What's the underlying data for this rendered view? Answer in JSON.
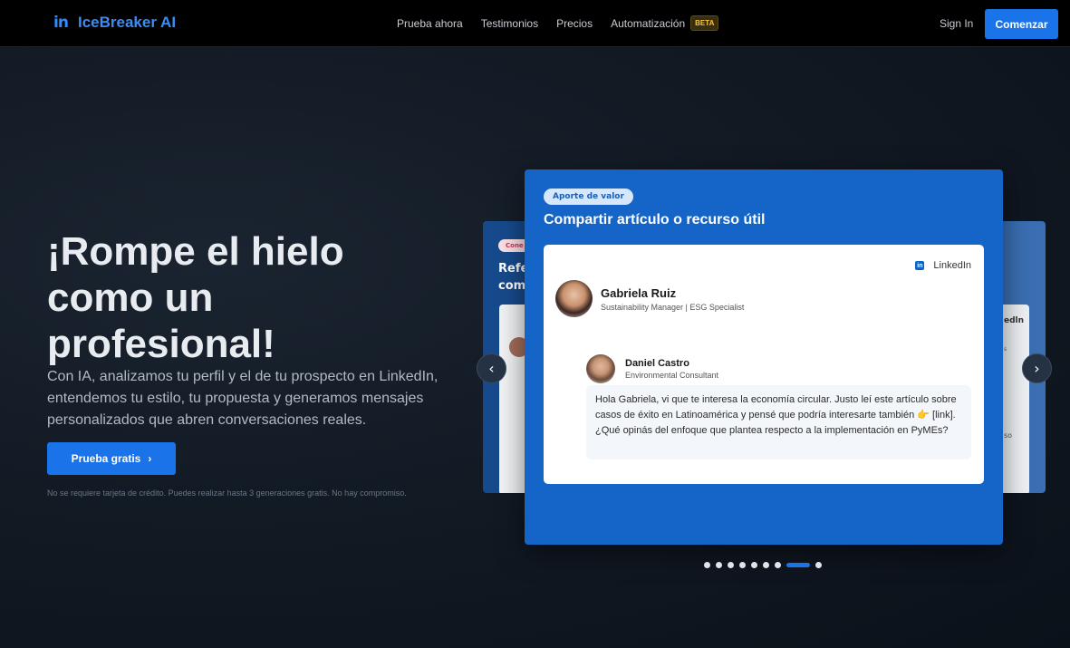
{
  "nav": {
    "logo_text": "IceBreaker AI",
    "links": [
      "Prueba ahora",
      "Testimonios",
      "Precios",
      "Automatización"
    ],
    "beta_badge": "BETA",
    "signin": "Sign In",
    "cta": "Comenzar"
  },
  "hero": {
    "title_line1": "¡Rompe el hielo",
    "title_line2": "como un",
    "title_line3": "profesional!",
    "subtitle": "Con IA, analizamos tu perfil y el de tu prospecto en LinkedIn, entendemos tu estilo, tu propuesta y generamos mensajes personalizados que abren conversaciones reales.",
    "button": "Prueba gratis",
    "disclaimer": "No se requiere tarjeta de crédito. Puedes realizar hasta 3 generaciones gratis. No hay compromiso."
  },
  "carousel": {
    "left_card": {
      "tag": "Cone",
      "title_line1": "Refe",
      "title_line2": "com"
    },
    "right_card": {
      "text1": "edln",
      "text2": "s",
      "text3": "so"
    },
    "main_card": {
      "tag": "Aporte de valor",
      "title": "Compartir artículo o recurso útil",
      "platform": "LinkedIn",
      "sender_name": "Gabriela Ruiz",
      "sender_role": "Sustainability Manager | ESG Specialist",
      "reply_name": "Daniel Castro",
      "reply_role": "Environmental Consultant",
      "message": "Hola Gabriela, vi que te interesa la economía circular. Justo leí este artículo sobre casos de éxito en Latinoamérica y pensé que podría interesarte también 👉 [link]. ¿Qué opinás del enfoque que plantea respecto a la implementación en PyMEs?"
    },
    "dots_count": 9,
    "active_dot": 7
  }
}
